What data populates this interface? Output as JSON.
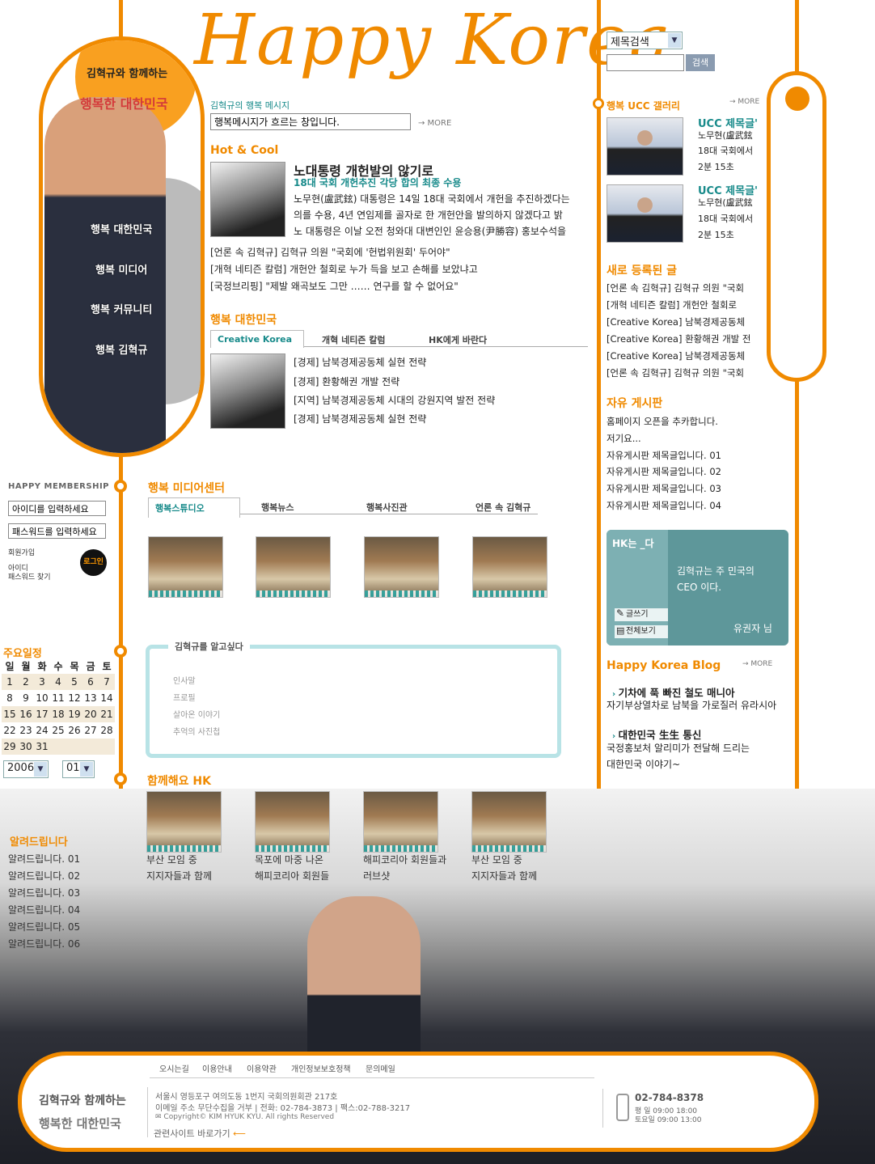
{
  "site": {
    "logo_text": "Happy Korea",
    "brand_line1": "김혁규와 함께하는",
    "brand_line2": "행복한 대한민국"
  },
  "search": {
    "select_value": "제목검색",
    "button": "검색"
  },
  "left_menu": [
    "행복 대한민국",
    "행복 미디어",
    "행복 커뮤니티",
    "행복 김혁규"
  ],
  "message": {
    "title": "김혁규의 행복 메시지",
    "input_value": "행복메시지가 흐르는 창입니다.",
    "more": "→ MORE"
  },
  "hot": {
    "title": "Hot & Cool",
    "headline": "노대통령 개헌발의 않기로",
    "sub": "18대 국회 개헌추진 각당 합의 최종 수용",
    "body": [
      "노무현(盧武鉉) 대통령은 14일 18대 국회에서 개헌을 추진하겠다는",
      "의를 수용, 4년 연임제를 골자로 한 개헌안을 발의하지 않겠다고 밝",
      "노 대통령은 이날 오전 청와대 대변인인 윤승용(尹勝容) 홍보수석을"
    ],
    "links": [
      "[언론 속 김혁규] 김혁규 의원 \"국회에 '헌법위원회' 두어야\"",
      "[개혁 네티즌 칼럼] 개헌안 철회로 누가 득을 보고 손해를 보았냐고",
      "[국정브리핑] \"제발 왜곡보도 그만 …… 연구를 할 수 없어요\""
    ]
  },
  "happy_korea": {
    "title": "행복 대한민국",
    "tabs": [
      "Creative Korea",
      "개혁 네티즌 칼럼",
      "HK에게 바란다"
    ],
    "items": [
      "[경제] 남북경제공동체 실현 전략",
      "[경제] 환황해권 개발 전략",
      "[지역] 남북경제공동체 시대의 강원지역 발전 전략",
      "[경제] 남북경제공동체 실현 전략"
    ]
  },
  "membership": {
    "title": "HAPPY MEMBERSHIP",
    "id_value": "아이디를 입력하세요",
    "pw_value": "패스워드를 입력하세요",
    "join": "회원가입",
    "find": "아이디",
    "find2": "패스워드 찾기",
    "login": "로그인"
  },
  "media": {
    "title": "행복 미디어센터",
    "tabs": [
      "행복스튜디오",
      "행복뉴스",
      "행복사진관",
      "언론 속 김혁규"
    ]
  },
  "schedule": {
    "title": "주요일정",
    "days": [
      "일",
      "월",
      "화",
      "수",
      "목",
      "금",
      "토"
    ],
    "weeks": [
      [
        "1",
        "2",
        "3",
        "4",
        "5",
        "6",
        "7"
      ],
      [
        "8",
        "9",
        "10",
        "11",
        "12",
        "13",
        "14"
      ],
      [
        "15",
        "16",
        "17",
        "18",
        "19",
        "20",
        "21"
      ],
      [
        "22",
        "23",
        "24",
        "25",
        "26",
        "27",
        "28"
      ],
      [
        "29",
        "30",
        "31",
        "",
        "",
        "",
        ""
      ]
    ],
    "year": "2006",
    "month": "01"
  },
  "know": {
    "title": "김혁규를 알고싶다",
    "items": [
      "인사말",
      "프로필",
      "살아온 이야기",
      "추억의 사진첩"
    ]
  },
  "together": {
    "title": "함께해요 HK",
    "captions": [
      [
        "부산 모임 중",
        "지지자들과 함께"
      ],
      [
        "목포에 마중 나온",
        "해피코리아 회원들"
      ],
      [
        "해피코리아 회원들과",
        "러브샷"
      ],
      [
        "부산 모임 중",
        "지지자들과 함께"
      ]
    ]
  },
  "notice": {
    "title": "알려드립니다",
    "items": [
      "알려드립니다. 01",
      "알려드립니다. 02",
      "알려드립니다. 03",
      "알려드립니다. 04",
      "알려드립니다. 05",
      "알려드립니다. 06"
    ]
  },
  "ucc": {
    "title": "행복 UCC 갤러리",
    "more": "→ MORE",
    "items": [
      {
        "title": "UCC 제목글'",
        "l1": "노무현(盧武鉉",
        "l2": "18대 국회에서",
        "l3": "2분 15초"
      },
      {
        "title": "UCC 제목글'",
        "l1": "노무현(盧武鉉",
        "l2": "18대 국회에서",
        "l3": "2분 15초"
      }
    ]
  },
  "new_posts": {
    "title": "새로 등록된 글",
    "items": [
      "[언론 속 김혁규] 김혁규 의원 \"국회",
      "[개혁 네티즌 칼럼] 개헌안 철회로",
      "[Creative Korea] 남북경제공동체",
      "[Creative Korea] 환황해권 개발 전",
      "[Creative Korea] 남북경제공동체",
      "[언론 속 김혁규] 김혁규 의원 \"국회"
    ]
  },
  "board": {
    "title": "자유 게시판",
    "items": [
      "홈페이지 오픈을 추카합니다.",
      "저기요...",
      "자유게시판 제목글입니다. 01",
      "자유게시판 제목글입니다. 02",
      "자유게시판 제목글입니다. 03",
      "자유게시판 제목글입니다. 04"
    ]
  },
  "hk_box": {
    "title": "HK는 _다",
    "text1": "김혁규는 주 민국의",
    "text2": "CEO 이다.",
    "write": "글쓰기",
    "view_all": "전체보기",
    "author": "유권자 님"
  },
  "blog": {
    "title": "Happy Korea Blog",
    "more": "→ MORE",
    "items": [
      {
        "title": "기차에 푹 빠진 철도 매니아",
        "text": "자기부상열차로 남북을 가로질러 유라시아"
      },
      {
        "title": "대한민국 生生 통신",
        "text": "국정홍보처 알리미가 전달해 드리는",
        "text2": "대한민국 이야기~"
      }
    ]
  },
  "footer": {
    "links": [
      "오시는길",
      "이용안내",
      "이용약관",
      "개인정보보호정책",
      "문의메일"
    ],
    "addr": "서울시 영등포구 여의도동 1번지 국회의원회관 217호",
    "addr2": "이메일 주소 무단수집을 거부 | 전화: 02-784-3873 | 팩스:02-788-3217",
    "copy": "Copyright© KIM HYUK KYU. All rights Reserved",
    "related": "관련사이트 바로가기",
    "phone": "02-784-8378",
    "hours1": "평   일 09:00 18:00",
    "hours2": "토요일 09:00 13:00"
  },
  "colors": {
    "accent": "#f08a00",
    "teal": "#5e979a"
  }
}
